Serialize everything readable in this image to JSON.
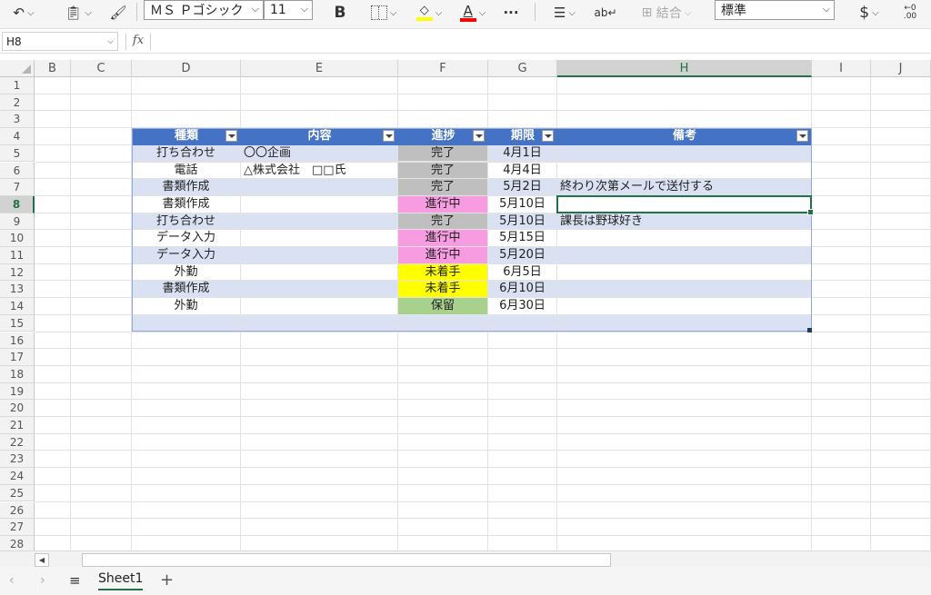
{
  "ribbon": {
    "undo_icon": "undo-icon",
    "paste_icon": "paste-icon",
    "format_painter_icon": "format-painter-icon",
    "font_name": "ＭＳ Ｐゴシック",
    "font_size": "11",
    "bold": "B",
    "borders_icon": "borders-icon",
    "fill_icon": "fill-color-icon",
    "fill_color": "#ffff00",
    "font_color_label": "A",
    "font_color": "#ff0000",
    "more": "···",
    "align_icon": "align-icon",
    "wrap_icon": "wrap-text-icon",
    "merge_label": "結合",
    "number_format": "標準",
    "currency": "$",
    "decimal_label": "←0\n.00"
  },
  "formula_bar": {
    "name_box": "H8",
    "fx": "fx",
    "formula": ""
  },
  "columns": [
    "B",
    "C",
    "D",
    "E",
    "F",
    "G",
    "H",
    "I",
    "J"
  ],
  "selected_column": "H",
  "rows": [
    "1",
    "2",
    "3",
    "4",
    "5",
    "6",
    "7",
    "8",
    "9",
    "10",
    "11",
    "12",
    "13",
    "14",
    "15",
    "16",
    "17",
    "18",
    "19",
    "20",
    "21",
    "22",
    "23",
    "24",
    "25",
    "26",
    "27",
    "28"
  ],
  "selected_row": "8",
  "table": {
    "headers": [
      "種類",
      "内容",
      "進捗",
      "期限",
      "備考"
    ],
    "rows": [
      {
        "type": "打ち合わせ",
        "content": "〇〇企画",
        "status": "完了",
        "status_color": "#bfbfbf",
        "due": "4月1日",
        "note": ""
      },
      {
        "type": "電話",
        "content": "△株式会社　□□氏",
        "status": "完了",
        "status_color": "#bfbfbf",
        "due": "4月4日",
        "note": ""
      },
      {
        "type": "書類作成",
        "content": "",
        "status": "完了",
        "status_color": "#bfbfbf",
        "due": "5月2日",
        "note": "終わり次第メールで送付する"
      },
      {
        "type": "書類作成",
        "content": "",
        "status": "進行中",
        "status_color": "#f79ce0",
        "due": "5月10日",
        "note": ""
      },
      {
        "type": "打ち合わせ",
        "content": "",
        "status": "完了",
        "status_color": "#bfbfbf",
        "due": "5月10日",
        "note": "課長は野球好き"
      },
      {
        "type": "データ入力",
        "content": "",
        "status": "進行中",
        "status_color": "#f79ce0",
        "due": "5月15日",
        "note": ""
      },
      {
        "type": "データ入力",
        "content": "",
        "status": "進行中",
        "status_color": "#f79ce0",
        "due": "5月20日",
        "note": ""
      },
      {
        "type": "外勤",
        "content": "",
        "status": "未着手",
        "status_color": "#ffff00",
        "due": "6月5日",
        "note": ""
      },
      {
        "type": "書類作成",
        "content": "",
        "status": "未着手",
        "status_color": "#ffff00",
        "due": "6月10日",
        "note": ""
      },
      {
        "type": "外勤",
        "content": "",
        "status": "保留",
        "status_color": "#a9d18e",
        "due": "6月30日",
        "note": ""
      },
      {
        "type": "",
        "content": "",
        "status": "",
        "status_color": "",
        "due": "",
        "note": ""
      }
    ]
  },
  "sheet_tabs": {
    "prev": "‹",
    "next": "›",
    "menu": "≡",
    "active_sheet": "Sheet1",
    "add": "+"
  },
  "colors": {
    "header_fill": "#4472c4",
    "band_fill": "#d9e1f2",
    "accent": "#217346"
  }
}
